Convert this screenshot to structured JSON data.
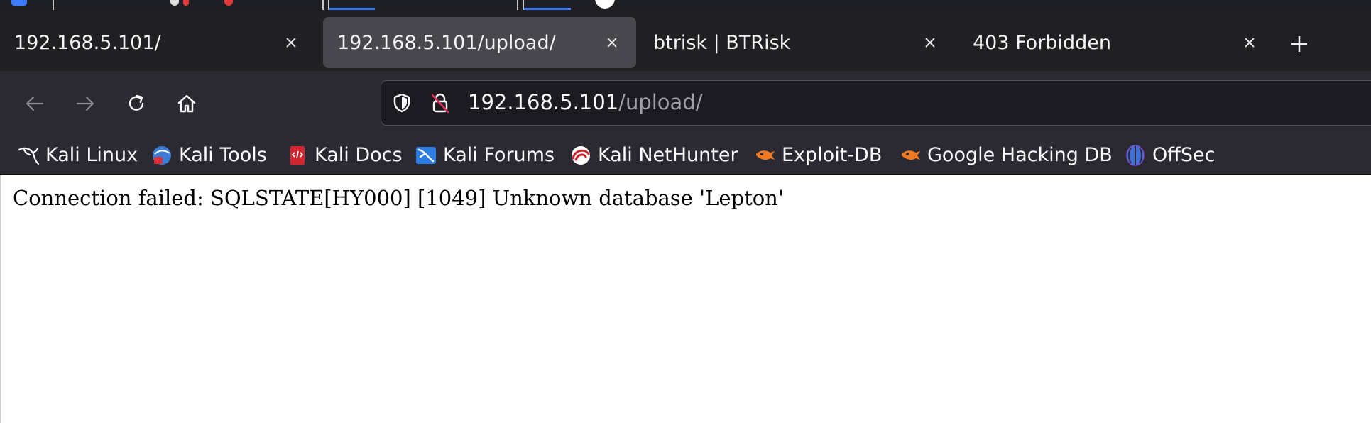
{
  "colors": {
    "tabstrip_bg": "#202022",
    "active_tab_bg": "#47474d",
    "toolbar_bg": "#2b2a33",
    "urlbar_bg": "#1c1b22",
    "accent": "#3d7bff"
  },
  "tabs": [
    {
      "title": "192.168.5.101/",
      "active": false,
      "close_icon": "close-icon"
    },
    {
      "title": "192.168.5.101/upload/",
      "active": true,
      "close_icon": "close-icon"
    },
    {
      "title": "btrisk | BTRisk",
      "active": false,
      "close_icon": "close-icon"
    },
    {
      "title": "403 Forbidden",
      "active": false,
      "close_icon": "close-icon"
    }
  ],
  "new_tab_icon": "plus-icon",
  "nav": {
    "back_icon": "arrow-left-icon",
    "forward_icon": "arrow-right-icon",
    "reload_icon": "reload-icon",
    "home_icon": "home-icon"
  },
  "urlbar": {
    "host": "192.168.5.101",
    "path": "/upload/",
    "shield_icon": "shield-icon",
    "insecure_icon": "insecure-lock-icon"
  },
  "bookmarks": [
    {
      "label": "Kali Linux",
      "icon": "kali-dragon-icon"
    },
    {
      "label": "Kali Tools",
      "icon": "kali-tools-icon"
    },
    {
      "label": "Kali Docs",
      "icon": "kali-docs-icon"
    },
    {
      "label": "Kali Forums",
      "icon": "kali-forums-icon"
    },
    {
      "label": "Kali NetHunter",
      "icon": "nethunter-icon"
    },
    {
      "label": "Exploit-DB",
      "icon": "exploit-db-icon"
    },
    {
      "label": "Google Hacking DB",
      "icon": "ghdb-icon"
    },
    {
      "label": "OffSec",
      "icon": "offsec-icon"
    }
  ],
  "page": {
    "message": "Connection failed: SQLSTATE[HY000] [1049] Unknown database 'Lepton'"
  }
}
